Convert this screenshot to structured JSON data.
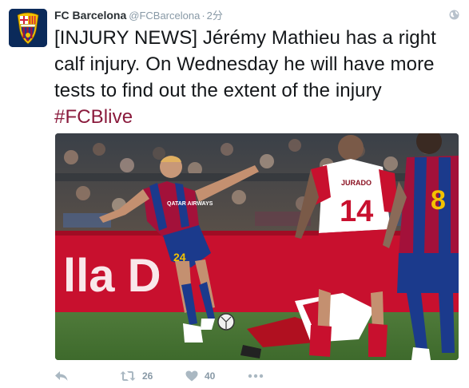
{
  "account": {
    "name": "FC Barcelona",
    "handle": "@FCBarcelona",
    "separator": "·",
    "time": "2分",
    "avatar_icon": "fc-barcelona-crest-icon"
  },
  "tweet": {
    "text": "[INJURY NEWS] Jérémy Mathieu has a right calf injury. On Wednesday he will have more tests to find out the extent of the injury ",
    "hashtag": "#FCBlive",
    "hashtag_color": "#8a1a3c"
  },
  "media": {
    "description_icon": "match-photo",
    "players": {
      "left_number": "24",
      "opponent_number": "14",
      "opponent_name": "JURADO",
      "right_number": "8",
      "shirt_sponsor": "QATAR AIRWAYS",
      "ad_board_text": "lla D"
    }
  },
  "actions": {
    "reply_icon": "reply-icon",
    "retweet_icon": "retweet-icon",
    "retweet_count": "26",
    "like_icon": "heart-icon",
    "like_count": "40",
    "more_icon": "more-dots-icon"
  },
  "colors": {
    "name": "#292f33",
    "meta": "#8899a6",
    "text": "#14171a",
    "barca_blue": "#1b3a8c",
    "barca_red": "#a3113a"
  }
}
